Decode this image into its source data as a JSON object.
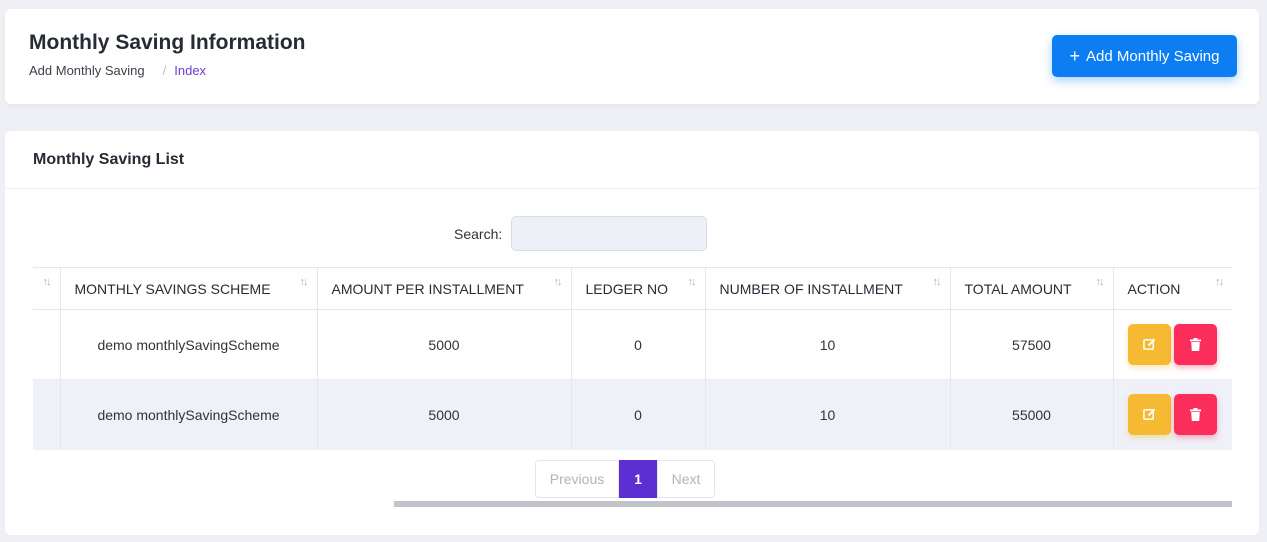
{
  "header": {
    "title": "Monthly Saving Information",
    "breadcrumb": [
      "Add Monthly Saving",
      "/",
      "Index"
    ],
    "add_button": "Add Monthly Saving"
  },
  "list": {
    "title": "Monthly Saving List",
    "search_label": "Search:",
    "search_value": "",
    "columns": [
      "",
      "MONTHLY SAVINGS SCHEME",
      "AMOUNT PER INSTALLMENT",
      "LEDGER NO",
      "NUMBER OF INSTALLMENT",
      "TOTAL AMOUNT",
      "ACTION"
    ],
    "rows": [
      {
        "scheme": "demo monthlySavingScheme",
        "amount": "5000",
        "ledger": "0",
        "installments": "10",
        "total": "57500"
      },
      {
        "scheme": "demo monthlySavingScheme",
        "amount": "5000",
        "ledger": "0",
        "installments": "10",
        "total": "55000"
      }
    ],
    "pagination": {
      "previous": "Previous",
      "current": "1",
      "next": "Next"
    }
  },
  "colors": {
    "primary": "#0d7df2",
    "edit": "#f6b932",
    "delete": "#fb2d5a",
    "active_page": "#5b2fd1"
  },
  "icons": {
    "sort": "sort-icon",
    "edit": "edit-icon",
    "delete": "trash-icon",
    "add": "plus-icon"
  }
}
